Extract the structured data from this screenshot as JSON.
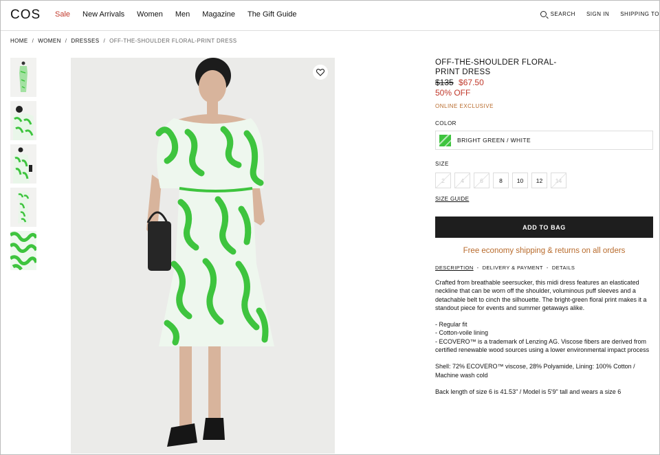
{
  "header": {
    "logo": "COS",
    "nav": [
      "Sale",
      "New Arrivals",
      "Women",
      "Men",
      "Magazine",
      "The Gift Guide"
    ],
    "search_label": "SEARCH",
    "signin_label": "SIGN IN",
    "shipping_label": "SHIPPING TO"
  },
  "breadcrumb": [
    "HOME",
    "WOMEN",
    "DRESSES",
    "OFF-THE-SHOULDER FLORAL-PRINT DRESS"
  ],
  "product": {
    "title": "OFF-THE-SHOULDER FLORAL-PRINT DRESS",
    "old_price": "$135",
    "new_price": "$67.50",
    "discount": "50% OFF",
    "badge": "ONLINE EXCLUSIVE",
    "color_label": "COLOR",
    "color_value": "BRIGHT GREEN / WHITE",
    "size_label": "SIZE",
    "sizes": [
      "2",
      "4",
      "6",
      "8",
      "10",
      "12",
      "14"
    ],
    "size_guide": "SIZE GUIDE",
    "add_to_bag": "ADD TO BAG",
    "shipping_note": "Free economy shipping & returns on all orders",
    "tabs": [
      "DESCRIPTION",
      "DELIVERY & PAYMENT",
      "DETAILS"
    ],
    "tab_sep": "-",
    "description": "Crafted from breathable seersucker, this midi dress features an elasticated neckline that can be worn off the shoulder, voluminous puff sleeves and a detachable belt to cinch the silhouette. The bright-green floral print makes it a standout piece for events and summer getaways alike.",
    "features": [
      "- Regular fit",
      "- Cotton-voile lining",
      "- ECOVERO™ is a trademark of Lenzing AG. Viscose fibers are derived from certified renewable wood sources using a lower environmental impact process"
    ],
    "composition": "Shell: 72% ECOVERO™ viscose, 28% Polyamide, Lining: 100% Cotton / Machine wash cold",
    "fit_note": "Back length of size 6 is 41.53\" / Model is 5'9\" tall and wears a size 6"
  },
  "colors": {
    "sale": "#c0392b",
    "accent": "#b86b2c",
    "button": "#1e1e1e",
    "print": "#3ec43e"
  }
}
